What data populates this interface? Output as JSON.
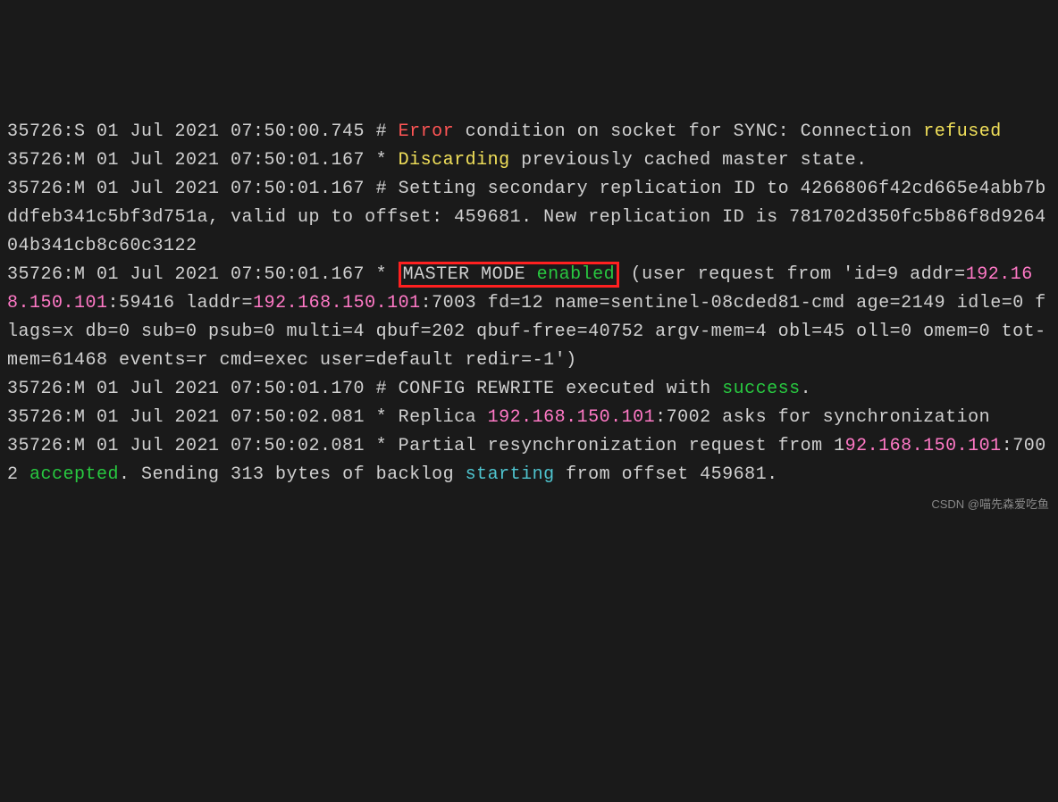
{
  "lines": [
    {
      "prefix": "35726:S 01 Jul 2021 07:50:00.745 # ",
      "segments": [
        {
          "text": "Error",
          "cls": "c-red"
        },
        {
          "text": " condition on socket for SYNC: Connection ",
          "cls": "c-white"
        },
        {
          "text": "refused",
          "cls": "c-yellow"
        }
      ]
    },
    {
      "prefix": "35726:M 01 Jul 2021 07:50:01.167 * ",
      "segments": [
        {
          "text": "Discarding",
          "cls": "c-yellow"
        },
        {
          "text": " previously cached master state.",
          "cls": "c-white"
        }
      ]
    },
    {
      "prefix": "35726:M 01 Jul 2021 07:50:01.167 # ",
      "segments": [
        {
          "text": "Setting secondary replication ID to 4266806f42cd665e4abb7bddfeb341c5bf3d751a, valid up to offset: 459681. New replication ID is 781702d350fc5b86f8d926404b341cb8c60c3122",
          "cls": "c-white"
        }
      ]
    },
    {
      "prefix": "35726:M 01 Jul 2021 07:50:01.167 * ",
      "segments": [
        {
          "text": "MASTER MODE ",
          "cls": "c-white",
          "boxed": true
        },
        {
          "text": "enabled",
          "cls": "c-green",
          "boxed": true
        },
        {
          "text": " (user request from 'id=9 addr=",
          "cls": "c-white"
        },
        {
          "text": "192.168.150.101",
          "cls": "c-magenta"
        },
        {
          "text": ":59416 laddr=",
          "cls": "c-white"
        },
        {
          "text": "192.168.150.101",
          "cls": "c-magenta"
        },
        {
          "text": ":7003 fd=12 name=sentinel-08cded81-cmd age=2149 idle=0 flags=x db=0 sub=0 psub=0 multi=4 qbuf=202 qbuf-free=40752 argv-mem=4 obl=45 oll=0 omem=0 tot-mem=61468 events=r cmd=exec user=default redir=-1')",
          "cls": "c-white"
        }
      ]
    },
    {
      "prefix": "35726:M 01 Jul 2021 07:50:01.170 # ",
      "segments": [
        {
          "text": "CONFIG REWRITE executed with ",
          "cls": "c-white"
        },
        {
          "text": "success",
          "cls": "c-green"
        },
        {
          "text": ".",
          "cls": "c-white"
        }
      ]
    },
    {
      "prefix": "35726:M 01 Jul 2021 07:50:02.081 * ",
      "segments": [
        {
          "text": "Replica ",
          "cls": "c-white"
        },
        {
          "text": "192.168.150.101",
          "cls": "c-magenta"
        },
        {
          "text": ":7002 asks for synchronization",
          "cls": "c-white"
        }
      ]
    },
    {
      "prefix": "35726:M 01 Jul 2021 07:50:02.081 * ",
      "segments": [
        {
          "text": "Partial resynchronization request from 1",
          "cls": "c-white"
        },
        {
          "text": "92.168.150.101",
          "cls": "c-magenta"
        },
        {
          "text": ":7002 ",
          "cls": "c-white"
        },
        {
          "text": "accepted",
          "cls": "c-green"
        },
        {
          "text": ". Sending 313 bytes of backlog ",
          "cls": "c-white"
        },
        {
          "text": "starting",
          "cls": "c-cyan"
        },
        {
          "text": " from offset 459681.",
          "cls": "c-white"
        }
      ]
    }
  ],
  "watermark": "CSDN @喵先森爱吃鱼"
}
